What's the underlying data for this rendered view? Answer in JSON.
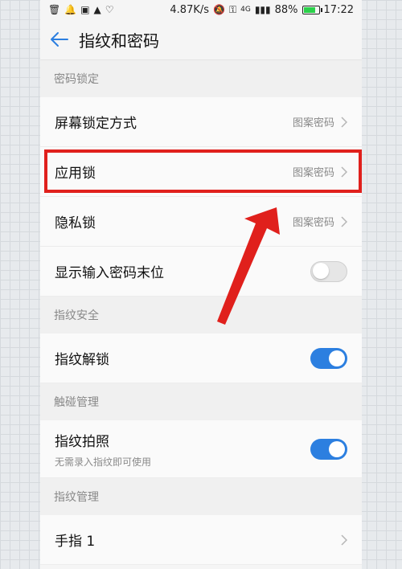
{
  "status_bar": {
    "speed": "4.87K/s",
    "network": "4G",
    "battery": "88%",
    "time": "17:22",
    "battery_level_percent": 88
  },
  "header": {
    "title": "指纹和密码"
  },
  "sections": [
    {
      "title": "密码锁定",
      "items": [
        {
          "label": "屏幕锁定方式",
          "value": "图案密码"
        },
        {
          "label": "应用锁",
          "value": "图案密码"
        },
        {
          "label": "隐私锁",
          "value": "图案密码"
        },
        {
          "label": "显示输入密码末位",
          "toggle": "off"
        }
      ]
    },
    {
      "title": "指纹安全",
      "items": [
        {
          "label": "指纹解锁",
          "toggle": "on"
        }
      ]
    },
    {
      "title": "触碰管理",
      "items": [
        {
          "label": "指纹拍照",
          "subtitle": "无需录入指纹即可使用",
          "toggle": "on"
        }
      ]
    },
    {
      "title": "指纹管理",
      "items": [
        {
          "label": "手指 1"
        }
      ]
    }
  ],
  "colors": {
    "accent": "#2c7fe0",
    "annotation": "#e0201c"
  }
}
